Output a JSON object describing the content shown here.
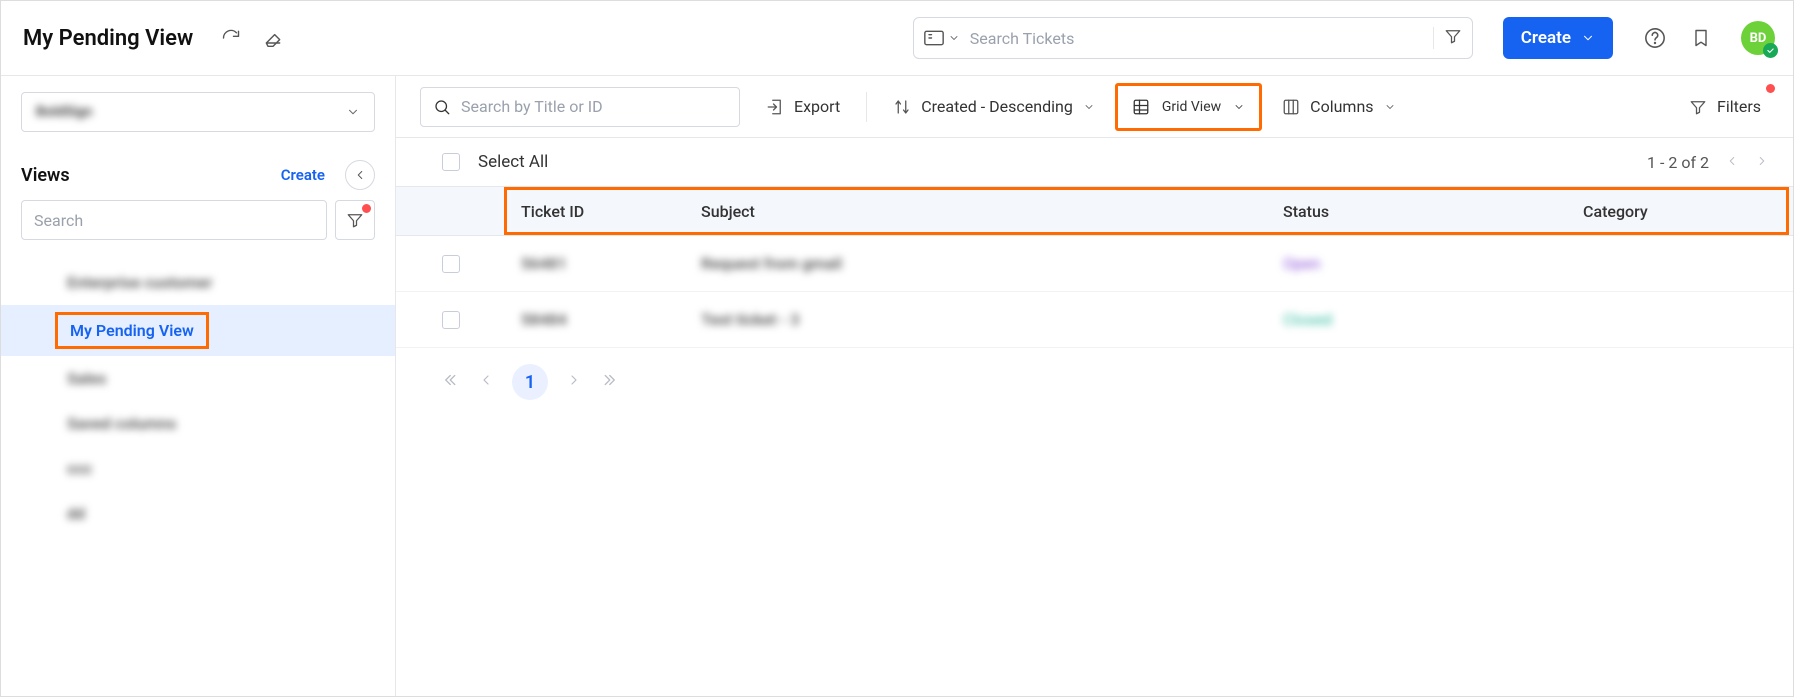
{
  "header": {
    "page_title": "My Pending View",
    "search_placeholder": "Search Tickets",
    "create_label": "Create",
    "avatar_initials": "BD"
  },
  "sidebar": {
    "dropdown_value": "BoldSign",
    "views_label": "Views",
    "views_create_label": "Create",
    "search_placeholder": "Search",
    "items": [
      {
        "label": "Enterprise customer",
        "active": false,
        "blurred": true
      },
      {
        "label": "My Pending View",
        "active": true,
        "blurred": false
      },
      {
        "label": "Sales",
        "active": false,
        "blurred": true
      },
      {
        "label": "Saved columns",
        "active": false,
        "blurred": true
      },
      {
        "label": "ccc",
        "active": false,
        "blurred": true
      },
      {
        "label": "dd",
        "active": false,
        "blurred": true
      }
    ]
  },
  "toolbar": {
    "search_placeholder": "Search by Title or ID",
    "export_label": "Export",
    "sort_label": "Created - Descending",
    "view_mode_label": "Grid View",
    "columns_label": "Columns",
    "filters_label": "Filters"
  },
  "selectall": {
    "label": "Select All",
    "range_text": "1 - 2 of 2"
  },
  "table": {
    "columns": {
      "id": "Ticket ID",
      "subject": "Subject",
      "status": "Status",
      "category": "Category"
    },
    "rows": [
      {
        "id": "56481",
        "subject": "Request from gmail",
        "status": "Open",
        "status_color": "#8a4fd8",
        "category": ""
      },
      {
        "id": "58484",
        "subject": "Test ticket - 3",
        "status": "Closed",
        "status_color": "#28b89b",
        "category": ""
      }
    ]
  },
  "pagination": {
    "current": "1"
  }
}
